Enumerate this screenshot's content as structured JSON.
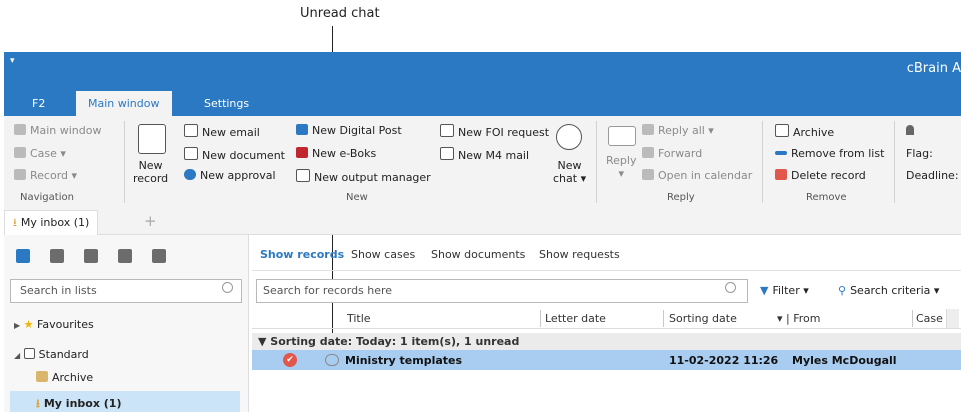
{
  "annotation": {
    "text": "Unread chat"
  },
  "titlebar": {
    "qa_arrow": "▾",
    "app_title": "cBrain A"
  },
  "ribbon_tabs": [
    "F2",
    "Main window",
    "Settings"
  ],
  "ribbon": {
    "navigation": {
      "items": [
        "Main window",
        "Case ▾",
        "Record ▾"
      ],
      "label": "Navigation"
    },
    "new_record": {
      "line1": "New",
      "line2": "record"
    },
    "new": {
      "items": [
        "New email",
        "New document",
        "New approval",
        "New Digital Post",
        "New e-Boks",
        "New output manager",
        "New FOI request",
        "New M4 mail"
      ],
      "chat_line1": "New",
      "chat_line2": "chat ▾",
      "label": "New"
    },
    "reply": {
      "big_label": "Reply",
      "big_arrow": "▾",
      "items": [
        "Reply all ▾",
        "Forward",
        "Open in calendar"
      ],
      "label": "Reply"
    },
    "remove": {
      "items": [
        "Archive",
        "Remove from list",
        "Delete record"
      ],
      "label": "Remove"
    },
    "flags": {
      "flag": "Flag:",
      "deadline": "Deadline:"
    }
  },
  "tabs": {
    "inbox": "My inbox (1)",
    "add": "+"
  },
  "left": {
    "search_placeholder": "Search in lists",
    "tree": {
      "favourites": "Favourites",
      "standard": "Standard",
      "archive": "Archive",
      "inbox": "My inbox (1)"
    }
  },
  "right": {
    "filter_tabs": [
      "Show records",
      "Show cases",
      "Show documents",
      "Show requests"
    ],
    "search_placeholder": "Search for records here",
    "filter": "Filter ▾",
    "search_criteria": "Search criteria ▾",
    "columns": [
      "Title",
      "Letter date",
      "Sorting date",
      "▾ | From",
      "Case"
    ],
    "group": "▼  Sorting date: Today: 1 item(s), 1 unread",
    "row": {
      "check": "✔",
      "title": "Ministry templates",
      "sorting_date": "11-02-2022 11:26",
      "from": "Myles McDougall"
    }
  },
  "colors": {
    "accent": "#2b79c2",
    "selected_row": "#a9cdf0",
    "tree_selected": "#cce4f7"
  }
}
